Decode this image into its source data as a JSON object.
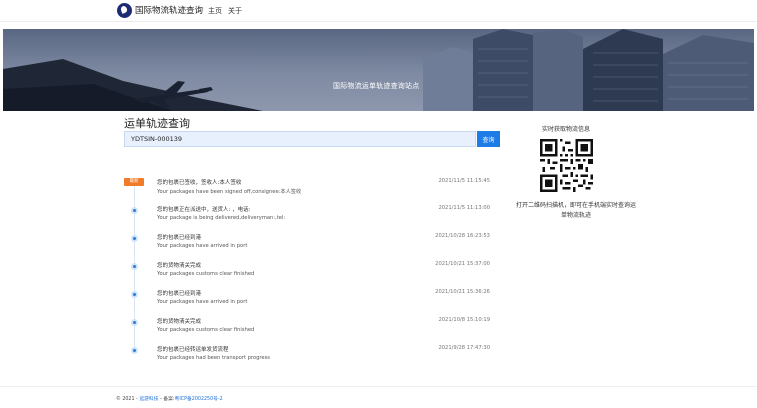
{
  "header": {
    "logo_icon": "globe-plane-icon",
    "title": "国际物流轨迹查询",
    "nav": [
      {
        "label": "主页"
      },
      {
        "label": "关于"
      }
    ]
  },
  "hero": {
    "caption": "国际物流运单轨迹查询站点"
  },
  "query": {
    "heading": "运单轨迹查询",
    "input_value": "YDTSIN-000139",
    "button_label": "查询",
    "accent_color": "#1e7ce6"
  },
  "qr_panel": {
    "title": "实时获取物流信息",
    "description": "打开二维码扫描机，即可在手机端实时查询运单物流轨迹"
  },
  "timeline": {
    "latest_badge": "最新",
    "badge_color": "#f07b2a",
    "events": [
      {
        "title": "您的包裹已签收，签收人:本人签收",
        "subtitle": "Your packages have been signed off,consignee:本人签收",
        "time": "2021/11/5 11:15:45"
      },
      {
        "title": "您的包裹正在派送中，送货人: ，电话:",
        "subtitle": "Your package is being delivered,deliveryman:,tel:",
        "time": "2021/11/5 11:13:00"
      },
      {
        "title": "您的包裹已经到港",
        "subtitle": "Your packages have arrived in port",
        "time": "2021/10/28 16:23:53"
      },
      {
        "title": "您的货物清关完成",
        "subtitle": "Your packages customs clear finished",
        "time": "2021/10/21 15:37:00"
      },
      {
        "title": "您的包裹已经到港",
        "subtitle": "Your packages have arrived in port",
        "time": "2021/10/21 15:36:26"
      },
      {
        "title": "您的货物清关完成",
        "subtitle": "Your packages customs clear finished",
        "time": "2021/10/8 15:10:19"
      },
      {
        "title": "您的包裹已经转运单发货流程",
        "subtitle": "Your packages had been transport progress",
        "time": "2021/9/28 17:47:30"
      }
    ]
  },
  "footer": {
    "prefix": "© 2021 -",
    "company": "远游科技",
    "middle": " - 备案:",
    "icp": "粤ICP备2002250号-2"
  }
}
